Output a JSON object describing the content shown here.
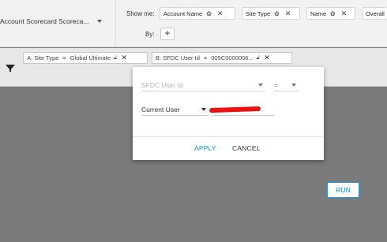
{
  "header": {
    "report_title": "Account Scorecard Scoreca...",
    "show_me_label": "Show me:",
    "by_label": "By:",
    "add_label": "+",
    "show_me_pills": [
      {
        "label": "Account Name"
      },
      {
        "label": "Site Type"
      },
      {
        "label": "Name"
      },
      {
        "label": "Overall"
      }
    ]
  },
  "filters": [
    {
      "prefix": "A.",
      "field": "Site Type",
      "operator": "=",
      "value": "Global Ultimate"
    },
    {
      "prefix": "B.",
      "field": "SFDC User Id",
      "operator": "=",
      "value": "005C0000006..."
    }
  ],
  "dialog": {
    "field_placeholder": "SFDC User Id",
    "operator": "=",
    "value_source": "Current User",
    "apply_label": "APPLY",
    "cancel_label": "CANCEL"
  },
  "run_label": "RUN",
  "colors": {
    "accent": "#1a8fd6",
    "redaction": "#ee1111",
    "canvas": "#7a7a7a"
  }
}
